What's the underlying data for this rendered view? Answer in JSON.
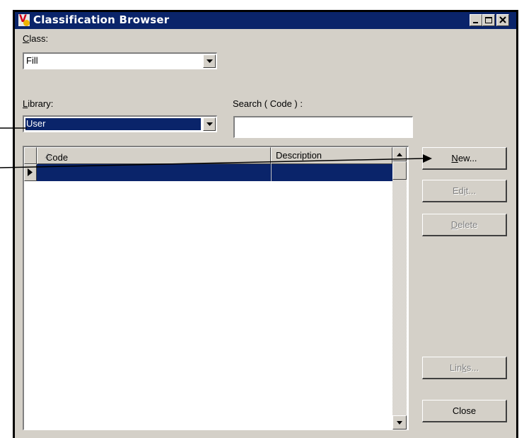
{
  "window": {
    "title": "Classification Browser",
    "title_bar_color": "#0a246a",
    "face_color": "#d4d0c8"
  },
  "class": {
    "label_u": "C",
    "label_rest": "lass:",
    "value": "Fill"
  },
  "library": {
    "label_u": "L",
    "label_rest": "ibrary:",
    "value": "User"
  },
  "search": {
    "label": "Search ( Code ) :",
    "value": ""
  },
  "grid": {
    "columns": [
      {
        "label": "Code",
        "sort": "ascending"
      },
      {
        "label": "Description"
      }
    ],
    "rows": [
      {
        "code": "",
        "description": "",
        "selected": true
      }
    ]
  },
  "buttons": {
    "new": {
      "u": "N",
      "rest": "ew...",
      "enabled": true
    },
    "edit": {
      "pre": "Ed",
      "u": "i",
      "post": "t...",
      "enabled": false
    },
    "delete": {
      "u": "D",
      "rest": "elete",
      "enabled": false
    },
    "links": {
      "pre": "Lin",
      "u": "k",
      "post": "s...",
      "enabled": false
    },
    "close": {
      "label": "Close",
      "enabled": true
    }
  },
  "caption_buttons": [
    "minimize-icon",
    "maximize-icon",
    "close-icon"
  ]
}
